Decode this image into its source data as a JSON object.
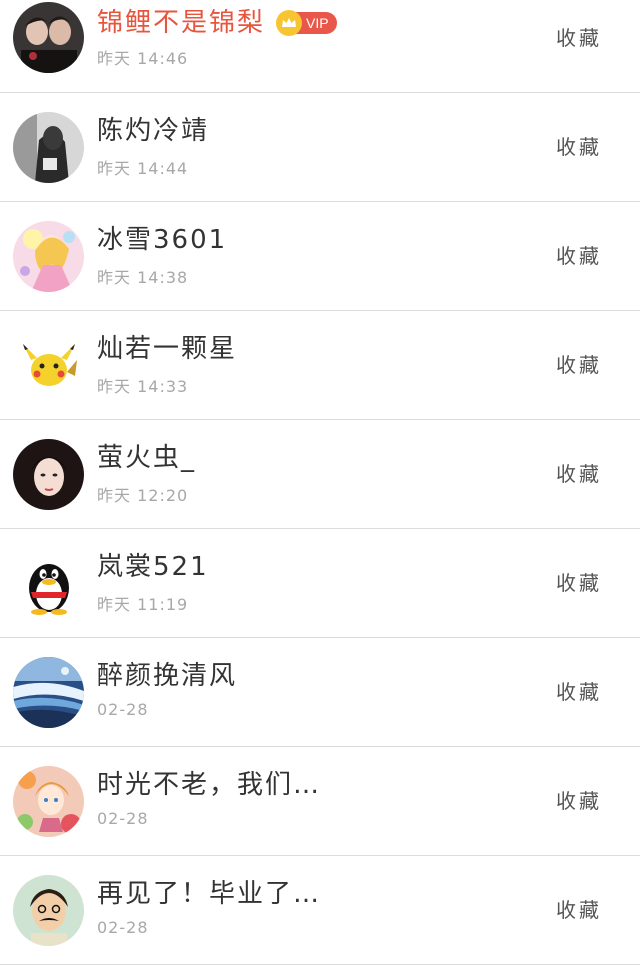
{
  "items": [
    {
      "name": "锦鲤不是锦梨",
      "time": "昨天 14:46",
      "action": "收藏",
      "vip": true,
      "vip_label": "VIP"
    },
    {
      "name": "陈灼冷靖",
      "time": "昨天 14:44",
      "action": "收藏"
    },
    {
      "name": "冰雪3601",
      "time": "昨天 14:38",
      "action": "收藏"
    },
    {
      "name": "灿若一颗星",
      "time": "昨天 14:33",
      "action": "收藏"
    },
    {
      "name": "萤火虫_",
      "time": "昨天 12:20",
      "action": "收藏"
    },
    {
      "name": "岚裳521",
      "time": "昨天 11:19",
      "action": "收藏"
    },
    {
      "name": "醉颜挽清风",
      "time": "02-28",
      "action": "收藏"
    },
    {
      "name": "时光不老，我们…",
      "time": "02-28",
      "action": "收藏"
    },
    {
      "name": "再见了！毕业了…",
      "time": "02-28",
      "action": "收藏"
    }
  ],
  "colors": {
    "vip_name": "#e8553f",
    "name": "#333333",
    "time": "#a8a8a8",
    "vip_tag": "#e9574b",
    "crown": "#f7c531"
  }
}
